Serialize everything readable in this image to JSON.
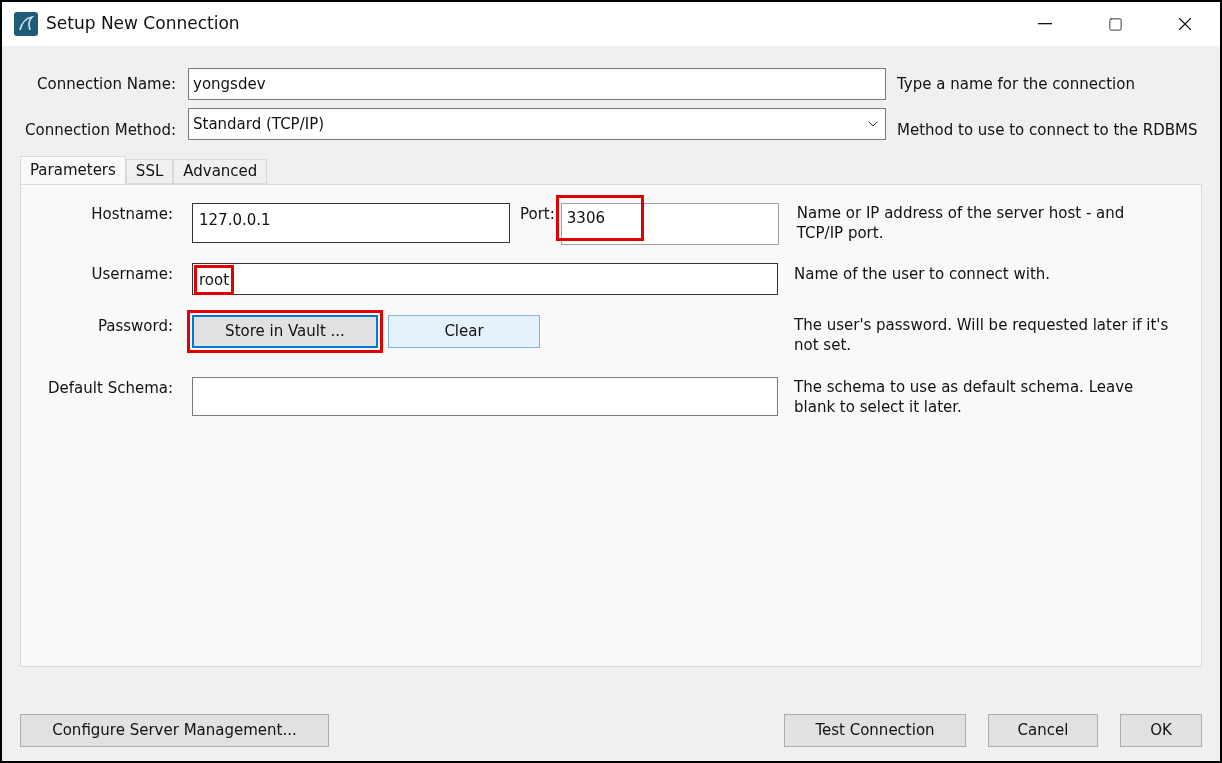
{
  "window": {
    "title": "Setup New Connection"
  },
  "connection_name": {
    "label": "Connection Name:",
    "value": "yongsdev",
    "hint": "Type a name for the connection"
  },
  "connection_method": {
    "label": "Connection Method:",
    "value": "Standard (TCP/IP)",
    "hint": "Method to use to connect to the RDBMS"
  },
  "tabs": [
    {
      "label": "Parameters",
      "selected": true
    },
    {
      "label": "SSL",
      "selected": false
    },
    {
      "label": "Advanced",
      "selected": false
    }
  ],
  "parameters": {
    "hostname": {
      "label": "Hostname:",
      "value": "127.0.0.1",
      "highlighted": false
    },
    "port": {
      "label": "Port:",
      "value": "3306",
      "highlighted": true
    },
    "host_hint": "Name or IP address of the server host - and TCP/IP port.",
    "username": {
      "label": "Username:",
      "value": "root",
      "highlighted": true,
      "hint": "Name of the user to connect with."
    },
    "password": {
      "label": "Password:",
      "buttons": [
        {
          "label": "Store in Vault ...",
          "focused": true,
          "highlighted": true
        },
        {
          "label": "Clear",
          "focused": false,
          "highlighted": false
        }
      ],
      "hint": "The user's password. Will be requested later if it's not set."
    },
    "default_schema": {
      "label": "Default Schema:",
      "hint": "The schema to use as default schema. Leave blank to select it later."
    }
  },
  "footer": {
    "left_button": "Configure Server Management...",
    "buttons": [
      "Test Connection",
      "Cancel",
      "OK"
    ]
  }
}
